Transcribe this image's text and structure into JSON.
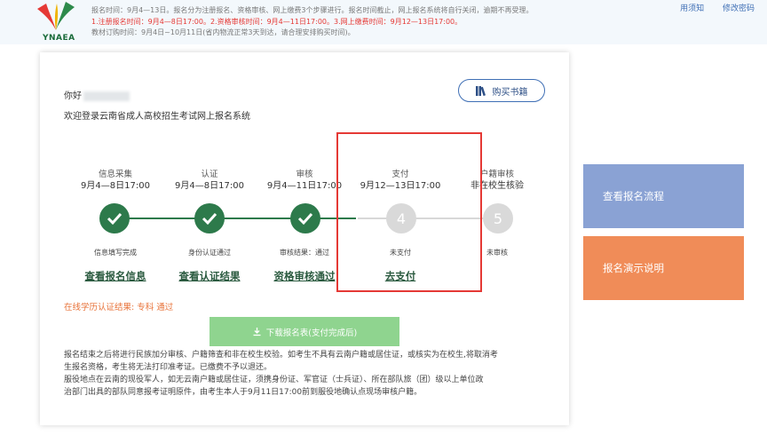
{
  "header": {
    "logo_text": "YNAEA",
    "notice_line1": "报名时间：9月4—13日。报名分为注册报名、资格审核、网上缴费3个步骤进行。报名时间截止，网上报名系统将自行关闭，逾期不再受理。",
    "notice_line2": "1.注册报名时间：9月4—8日17:00。2.资格审核时间：9月4—11日17:00。3.网上缴费时间：9月12—13日17:00。",
    "notice_line3": "教材订购时间：9月4日~10月11日(省内物流正常3天到达，请合理安排购买时间)。",
    "link_partial": "用须知",
    "link_modify": "修改密码"
  },
  "card": {
    "greeting": "你好",
    "welcome": "欢迎登录云南省成人高校招生考试网上报名系统",
    "buy_label": "购买书籍",
    "edu_result": "在线学历认证结果: 专科 通过",
    "download_label": "下载报名表(支付完成后)",
    "footer_line1": "报名结束之后将进行民族加分审核、户籍筛查和非在校生校验。如考生不具有云南户籍或居住证，或核实为在校生,将取消考",
    "footer_line2": "生报名资格，考生将无法打印准考证。已缴费不予以退还。",
    "footer_line3": "服役地点在云南的现役军人，如无云南户籍或居住证，须携身份证、军官证（士兵证）、所在部队旅（团）级以上单位政",
    "footer_line4": "治部门出具的部队同意报考证明原件，由考生本人于9月11日17:00前到服役地确认点现场审核户籍。"
  },
  "steps": [
    {
      "title": "信息采集",
      "date": "9月4—8日17:00",
      "status": "信息填写完成",
      "link": "查看报名信息"
    },
    {
      "title": "认证",
      "date": "9月4—8日17:00",
      "status": "身份认证通过",
      "link": "查看认证结果"
    },
    {
      "title": "审核",
      "date": "9月4—11日17:00",
      "status": "审核结果：通过",
      "link": "资格审核通过"
    },
    {
      "title": "支付",
      "date": "9月12—13日17:00",
      "number": "4",
      "status": "未支付",
      "link": "去支付"
    },
    {
      "title": "户籍审核",
      "date": "非在校生核验",
      "number": "5",
      "status": "未审核"
    }
  ],
  "side": {
    "flow_label": "查看报名流程",
    "demo_label": "报名演示说明"
  },
  "colors": {
    "primary_green": "#2d7a4b",
    "highlight_red": "#e53935",
    "download_green": "#8fd48f",
    "side_blue": "#8aa2d4",
    "side_orange": "#f08c58"
  }
}
